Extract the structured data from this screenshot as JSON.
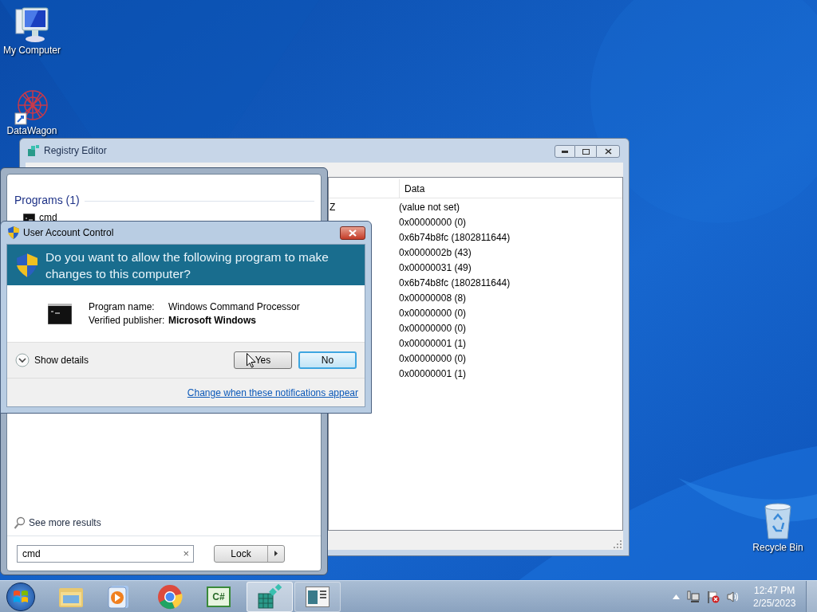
{
  "desktop_icons": [
    {
      "label": "My Computer"
    },
    {
      "label": "DataWagon"
    },
    {
      "label": "Recycle Bin"
    }
  ],
  "registry_editor": {
    "title": "Registry Editor",
    "columns": [
      "Data"
    ],
    "type_cells": [
      "Z"
    ],
    "data_rows": [
      "(value not set)",
      "0x00000000 (0)",
      "0x6b74b8fc (1802811644)",
      "0x0000002b (43)",
      "0x00000031 (49)",
      "0x6b74b8fc (1802811644)",
      "0x00000008 (8)",
      "0x00000000 (0)",
      "0x00000000 (0)",
      "0x00000001 (1)",
      "0x00000000 (0)",
      "0x00000001 (1)"
    ]
  },
  "start_menu": {
    "section": "Programs (1)",
    "results": [
      "cmd"
    ],
    "see_more": "See more results",
    "search": {
      "value": "cmd",
      "clear": "×"
    },
    "power_button": "Lock"
  },
  "uac": {
    "title": "User Account Control",
    "question": "Do you want to allow the following program to make changes to this computer?",
    "program_label": "Program name:",
    "program_name": "Windows Command Processor",
    "publisher_label": "Verified publisher:",
    "publisher": "Microsoft Windows",
    "details": "Show details",
    "buttons": [
      {
        "label": "Yes",
        "default": false
      },
      {
        "label": "No",
        "default": true
      }
    ],
    "link": "Change when these notifications appear"
  },
  "taskbar": {
    "apps": [
      {
        "selected": false
      },
      {
        "selected": false
      },
      {
        "selected": false
      },
      {
        "selected": false,
        "glyph": "C#"
      },
      {
        "selected": true
      },
      {
        "selected": false
      }
    ],
    "clock": {
      "time": "12:47 PM",
      "date": "2/25/2023"
    }
  }
}
